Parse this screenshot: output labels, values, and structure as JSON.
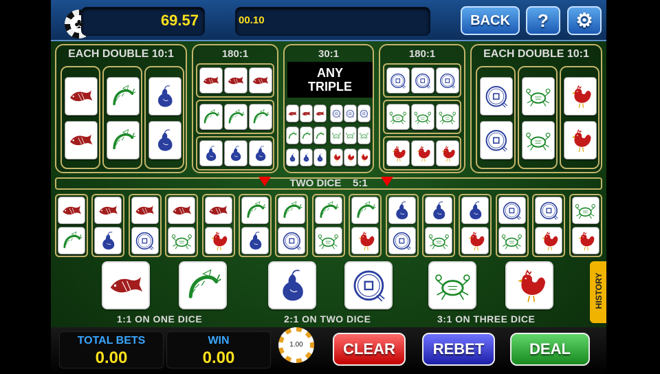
{
  "header": {
    "chip_icon": "club-chip-icon",
    "balance": "69.57",
    "bet_amount": "00.10",
    "back_label": "BACK",
    "help_label": "?",
    "settings_icon": "gear-icon"
  },
  "board": {
    "left_doubles": {
      "title": "EACH DOUBLE 10:1",
      "symbols": [
        "fish",
        "shrimp",
        "gourd"
      ]
    },
    "left_triples": {
      "title": "180:1",
      "symbols": [
        "fish",
        "shrimp",
        "gourd"
      ]
    },
    "any_triple": {
      "odds": "30:1",
      "line1": "ANY",
      "line2": "TRIPLE",
      "symbols": [
        "fish",
        "coin",
        "shrimp",
        "crab",
        "gourd",
        "rooster"
      ]
    },
    "right_triples": {
      "title": "180:1",
      "symbols": [
        "coin",
        "crab",
        "rooster"
      ]
    },
    "right_doubles": {
      "title": "EACH DOUBLE 10:1",
      "symbols": [
        "coin",
        "crab",
        "rooster"
      ]
    }
  },
  "two_dice": {
    "label": "TWO DICE    5:1",
    "pairs": [
      [
        "fish",
        "shrimp"
      ],
      [
        "fish",
        "gourd"
      ],
      [
        "fish",
        "coin"
      ],
      [
        "fish",
        "crab"
      ],
      [
        "fish",
        "rooster"
      ],
      [
        "shrimp",
        "gourd"
      ],
      [
        "shrimp",
        "coin"
      ],
      [
        "shrimp",
        "crab"
      ],
      [
        "shrimp",
        "rooster"
      ],
      [
        "gourd",
        "coin"
      ],
      [
        "gourd",
        "crab"
      ],
      [
        "gourd",
        "rooster"
      ],
      [
        "coin",
        "crab"
      ],
      [
        "coin",
        "rooster"
      ],
      [
        "crab",
        "rooster"
      ]
    ]
  },
  "single": {
    "symbols": [
      "fish",
      "shrimp",
      "gourd",
      "coin",
      "crab",
      "rooster"
    ],
    "caption_1": "1:1 ON ONE DICE",
    "caption_2": "2:1 ON TWO DICE",
    "caption_3": "3:1 ON THREE DICE",
    "history_label": "HISTORY"
  },
  "footer": {
    "total_bets_label": "TOTAL BETS",
    "total_bets_value": "0.00",
    "win_label": "WIN",
    "win_value": "0.00",
    "chip_value": "1.00",
    "clear_label": "CLEAR",
    "rebet_label": "REBET",
    "deal_label": "DEAL"
  },
  "colors": {
    "fish": "#a31d1d",
    "shrimp": "#1d8a2a",
    "gourd": "#2a3f9e",
    "coin": "#2a3f9e",
    "crab": "#1d8a2a",
    "rooster": "#c41a1a"
  }
}
